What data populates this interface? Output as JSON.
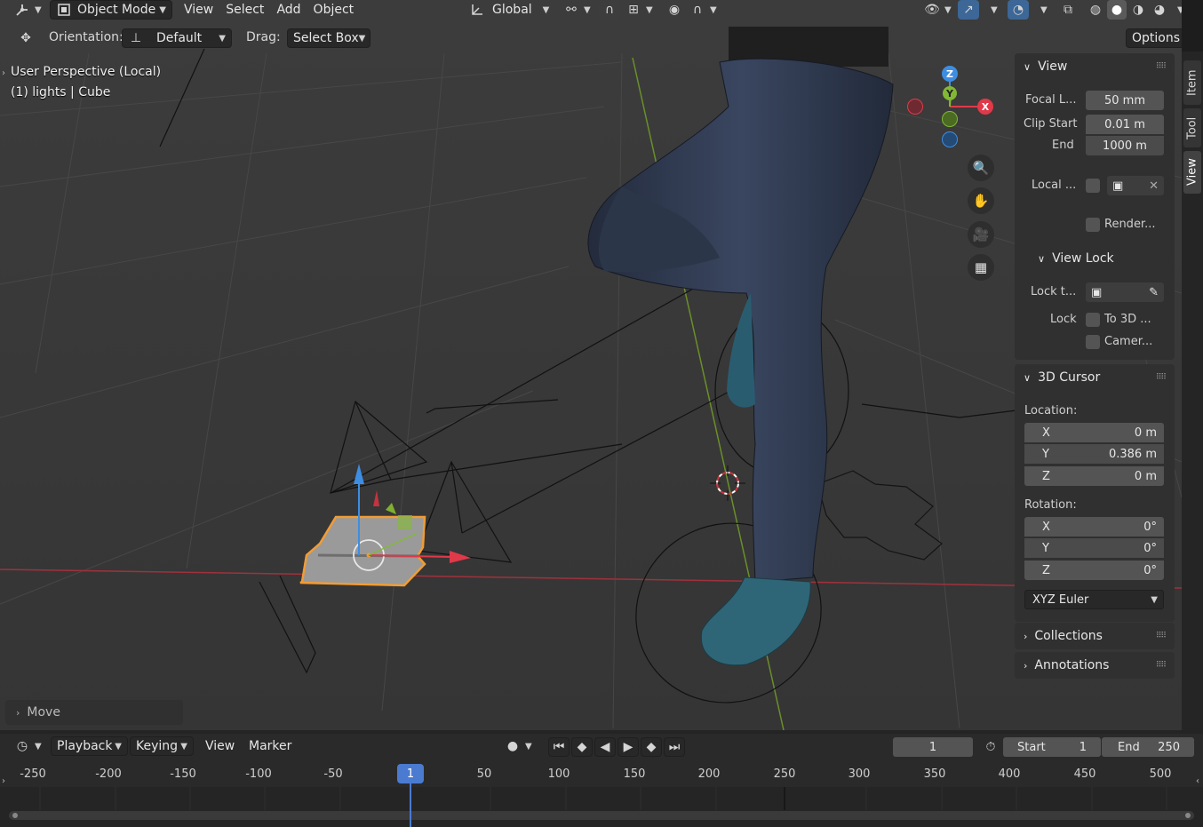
{
  "header": {
    "mode_label": "Object Mode",
    "menus": [
      "View",
      "Select",
      "Add",
      "Object"
    ],
    "transform_orientation": "Global"
  },
  "tool_settings": {
    "orientation_label": "Orientation:",
    "orientation_value": "Default",
    "drag_label": "Drag:",
    "drag_value": "Select Box",
    "options_label": "Options"
  },
  "viewport": {
    "perspective_text": "User Perspective (Local)",
    "object_text": "(1) lights | Cube",
    "gizmo_axes": {
      "x": "X",
      "y": "Y",
      "z": "Z"
    },
    "axis_colors": {
      "x": "#e0394a",
      "y": "#82b934",
      "z": "#3d8ee2"
    }
  },
  "last_operator": "Move",
  "npanel": {
    "tabs": [
      "Item",
      "Tool",
      "View"
    ],
    "active_tab": "View",
    "view": {
      "title": "View",
      "focal_label": "Focal L...",
      "focal_value": "50 mm",
      "clip_start_label": "Clip Start",
      "clip_start_value": "0.01 m",
      "end_label": "End",
      "end_value": "1000 m",
      "local_label": "Local ...",
      "render_label": "Render..."
    },
    "view_lock": {
      "title": "View Lock",
      "lock_to_label": "Lock t...",
      "lock_label": "Lock",
      "to_3d_label": "To 3D ...",
      "camera_label": "Camer..."
    },
    "cursor": {
      "title": "3D Cursor",
      "location_label": "Location:",
      "loc": [
        {
          "axis": "X",
          "value": "0 m"
        },
        {
          "axis": "Y",
          "value": "0.386 m"
        },
        {
          "axis": "Z",
          "value": "0 m"
        }
      ],
      "rotation_label": "Rotation:",
      "rot": [
        {
          "axis": "X",
          "value": "0°"
        },
        {
          "axis": "Y",
          "value": "0°"
        },
        {
          "axis": "Z",
          "value": "0°"
        }
      ],
      "rotation_mode": "XYZ Euler"
    },
    "collections_title": "Collections",
    "annotations_title": "Annotations"
  },
  "timeline": {
    "menus": [
      "Playback",
      "Keying",
      "View",
      "Marker"
    ],
    "current_frame": "1",
    "start_label": "Start",
    "start_value": "1",
    "end_label": "End",
    "end_value": "250",
    "ruler_ticks": [
      "-250",
      "-200",
      "-150",
      "-100",
      "-50",
      "1",
      "50",
      "100",
      "150",
      "200",
      "250",
      "300",
      "350",
      "400",
      "450",
      "500"
    ],
    "playhead_label": "1"
  }
}
